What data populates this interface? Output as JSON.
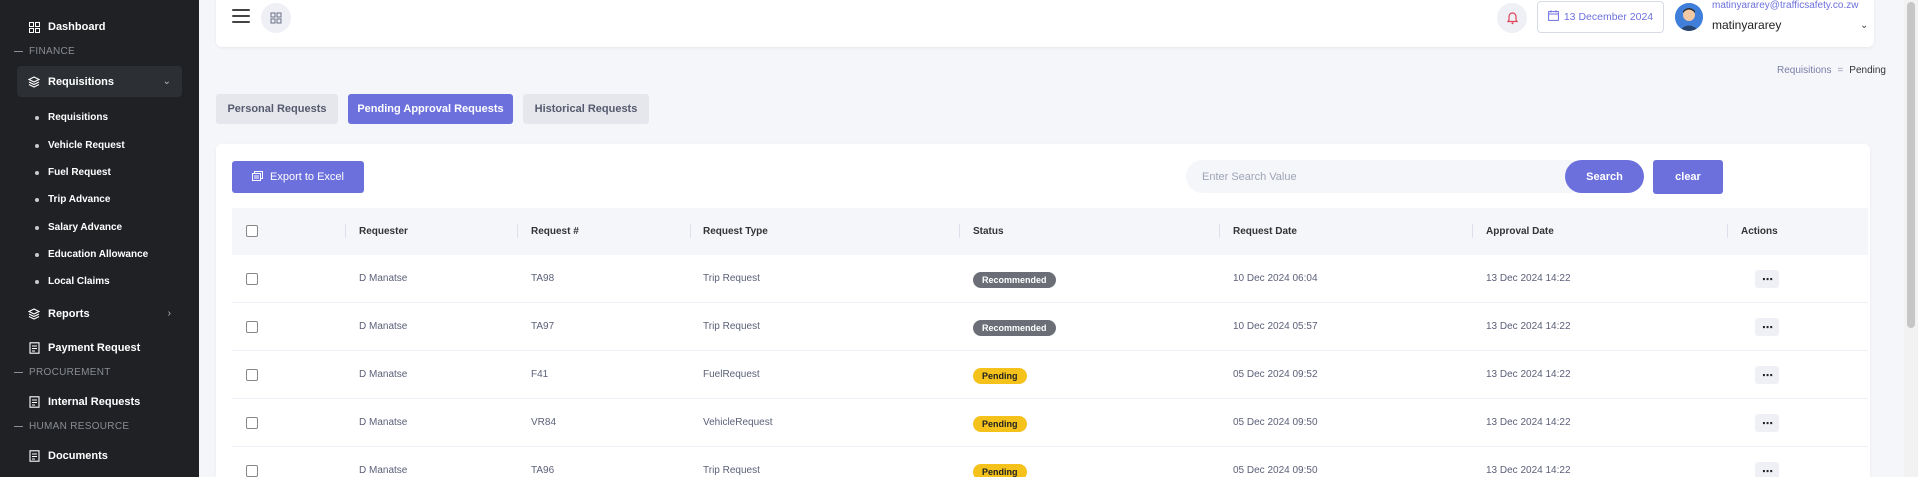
{
  "sidebar": {
    "dashboard": "Dashboard",
    "section_finance": "FINANCE",
    "requisitions": "Requisitions",
    "sub_items": [
      {
        "label": "Requisitions"
      },
      {
        "label": "Vehicle Request"
      },
      {
        "label": "Fuel Request"
      },
      {
        "label": "Trip Advance"
      },
      {
        "label": "Salary Advance"
      },
      {
        "label": "Education Allowance"
      },
      {
        "label": "Local Claims"
      }
    ],
    "reports": "Reports",
    "payment_request": "Payment Request",
    "section_procurement": "PROCUREMENT",
    "internal_requests": "Internal Requests",
    "section_hr": "HUMAN RESOURCE",
    "documents": "Documents"
  },
  "header": {
    "date": "13 December 2024",
    "user_email": "matinyararey@trafficsafety.co.zw",
    "user_name": "matinyararey"
  },
  "breadcrumb": {
    "parent": "Requisitions",
    "separator": "=",
    "current": "Pending"
  },
  "tabs": [
    {
      "label": "Personal Requests"
    },
    {
      "label": "Pending Approval Requests"
    },
    {
      "label": "Historical Requests"
    }
  ],
  "toolbar": {
    "export_label": "Export to Excel",
    "search_placeholder": "Enter Search Value",
    "search_label": "Search",
    "clear_label": "clear"
  },
  "table": {
    "columns": [
      "Requester",
      "Request #",
      "Request Type",
      "Status",
      "Request Date",
      "Approval Date",
      "Actions"
    ],
    "rows": [
      {
        "requester": "D Manatse",
        "request_no": "TA98",
        "type": "Trip Request",
        "status": "Recommended",
        "request_date": "10 Dec 2024 06:04",
        "approval_date": "13 Dec 2024 14:22"
      },
      {
        "requester": "D Manatse",
        "request_no": "TA97",
        "type": "Trip Request",
        "status": "Recommended",
        "request_date": "10 Dec 2024 05:57",
        "approval_date": "13 Dec 2024 14:22"
      },
      {
        "requester": "D Manatse",
        "request_no": "F41",
        "type": "FuelRequest",
        "status": "Pending",
        "request_date": "05 Dec 2024 09:52",
        "approval_date": "13 Dec 2024 14:22"
      },
      {
        "requester": "D Manatse",
        "request_no": "VR84",
        "type": "VehicleRequest",
        "status": "Pending",
        "request_date": "05 Dec 2024 09:50",
        "approval_date": "13 Dec 2024 14:22"
      },
      {
        "requester": "D Manatse",
        "request_no": "TA96",
        "type": "Trip Request",
        "status": "Pending",
        "request_date": "05 Dec 2024 09:50",
        "approval_date": "13 Dec 2024 14:22"
      }
    ]
  },
  "colors": {
    "accent": "#6c70dc",
    "sidebar_bg": "#1f2125",
    "recommended": "#6b6e76",
    "pending": "#f5c21b"
  }
}
